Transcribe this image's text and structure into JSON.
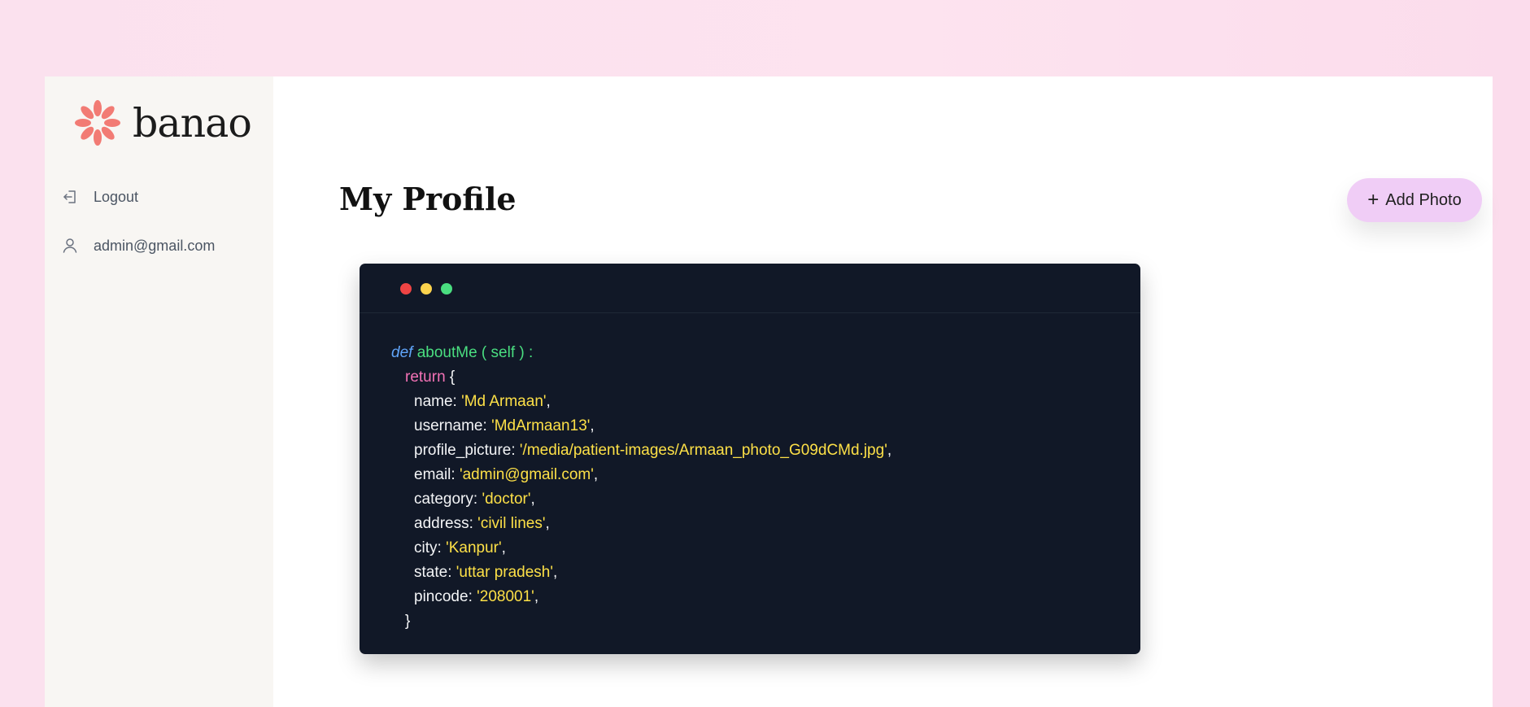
{
  "brand": {
    "name": "banao",
    "logo_color": "#f27b74"
  },
  "sidebar": {
    "items": [
      {
        "label": "Logout",
        "icon": "logout-icon"
      },
      {
        "label": "admin@gmail.com",
        "icon": "user-icon"
      }
    ]
  },
  "main": {
    "title": "My Profile",
    "add_photo_label": "Add Photo",
    "add_photo_icon": "plus-icon"
  },
  "code": {
    "def_keyword": "def",
    "signature": "aboutMe ( self ) :",
    "return_keyword": "return",
    "open_brace": "{",
    "close_brace": "}",
    "fields": [
      {
        "key": "name",
        "value": "Md Armaan"
      },
      {
        "key": "username",
        "value": "MdArmaan13"
      },
      {
        "key": "profile_picture",
        "value": "/media/patient-images/Armaan_photo_G09dCMd.jpg"
      },
      {
        "key": "email",
        "value": "admin@gmail.com"
      },
      {
        "key": "category",
        "value": "doctor"
      },
      {
        "key": "address",
        "value": "civil lines"
      },
      {
        "key": "city",
        "value": "Kanpur"
      },
      {
        "key": "state",
        "value": "uttar pradesh"
      },
      {
        "key": "pincode",
        "value": "208001"
      }
    ]
  },
  "colors": {
    "page_bg": "#fde3ef",
    "sidebar_bg": "#f8f6f3",
    "code_bg": "#111827",
    "button_bg": "#f0cdf6"
  }
}
